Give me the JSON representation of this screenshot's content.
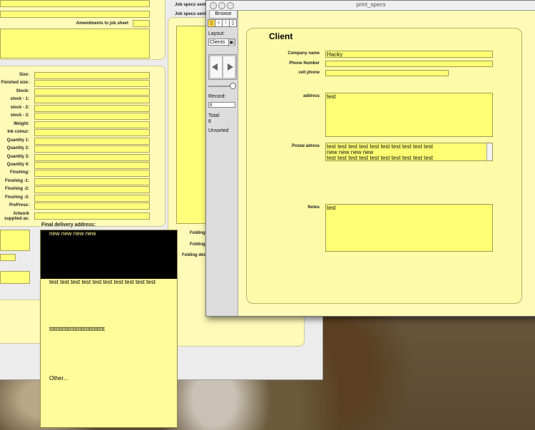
{
  "back_window": {
    "job_specs_sent_1": "Job specs sent",
    "job_specs_sent_2": "Job specs sent",
    "amendments_label": "Amendments to job sheet",
    "spec_labels": [
      "Size:",
      "Finished size:",
      "Stock:",
      "stock - 1:",
      "stock - 2:",
      "stock - 3:",
      "Weight:",
      "Ink colour:",
      "Quantity 1:",
      "Quantity 2:",
      "Quantity 3:",
      "Quantity 4:",
      "Finshing:",
      "Finshing -1:",
      "Finshing -2:",
      "Finshing -3:",
      "PrePress:"
    ],
    "artwork_label_1": "Artwork",
    "artwork_label_2": "supplied as:",
    "final_delivery_label": "Final delivery address:",
    "folding_labels": [
      "Folding d",
      "Folding d",
      "Folding detai"
    ]
  },
  "delivery_panel": {
    "line1": "new new new new",
    "line2": "test test test test test test test test test test",
    "line3": "ttttttttttttttttttttttttttttttttttt",
    "line4": "Other..."
  },
  "front_window": {
    "title": "print_specs",
    "status": {
      "mode_tab": "Browse",
      "layout_label": "Layout:",
      "layout_value": "Clients",
      "record_label": "Record:",
      "record_value": "8",
      "total_label": "Total:",
      "total_value": "8",
      "sort_status": "Unsorted"
    },
    "client": {
      "heading": "Client",
      "company_name_label": "Company name",
      "company_name_value": "Hacky",
      "phone_label": "Phone Number",
      "phone_value": "",
      "cell_label": "cell phone",
      "cell_value": "",
      "address_label": "address",
      "address_value": "test",
      "postal_label": "Postal adress",
      "postal_lines": [
        "test test test test test test test test test test",
        "new new new new",
        "test test test test test test test test test test"
      ],
      "notes_label": "Notes",
      "notes_value": "test"
    }
  }
}
